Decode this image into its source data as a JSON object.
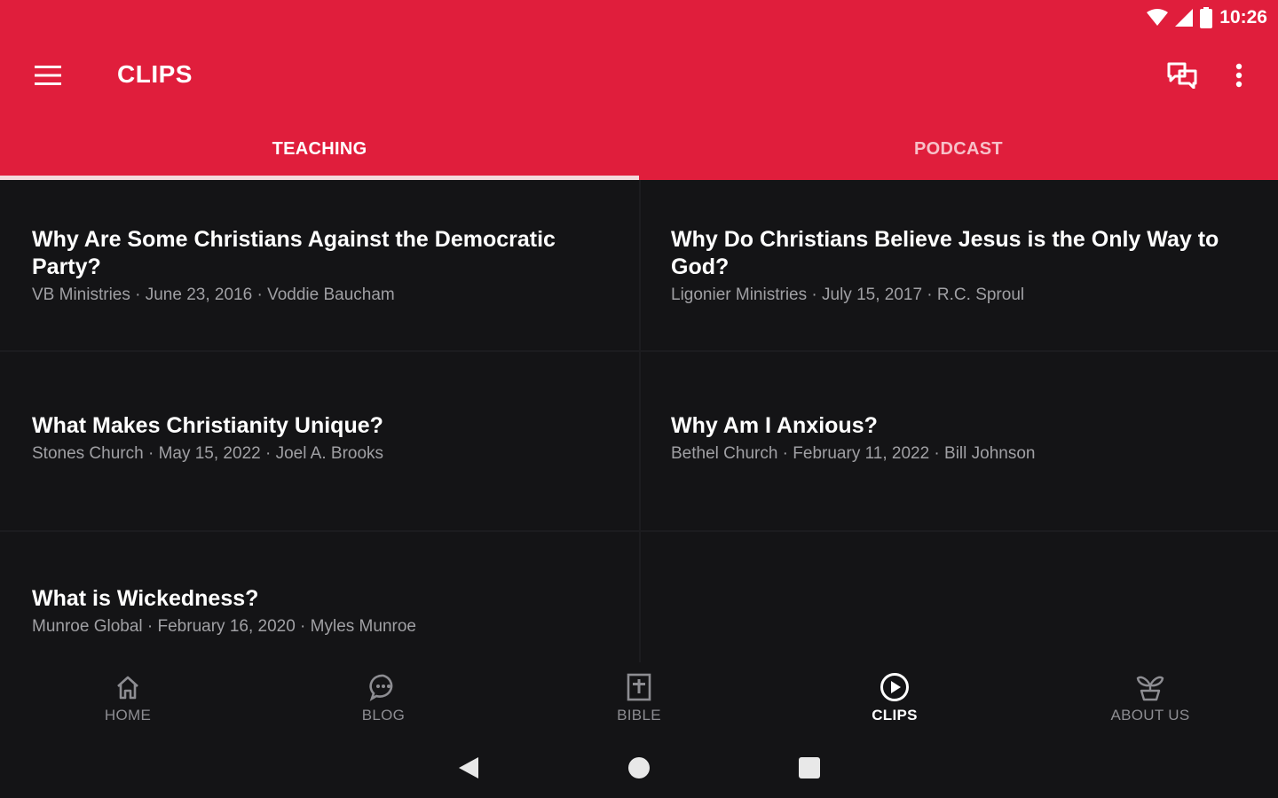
{
  "status_bar": {
    "time": "10:26"
  },
  "toolbar": {
    "title": "CLIPS"
  },
  "tabs": [
    {
      "label": "TEACHING",
      "active": true
    },
    {
      "label": "PODCAST",
      "active": false
    }
  ],
  "clips": [
    {
      "title": "Why Are Some Christians Against the Democratic Party?",
      "meta": "VB Ministries · June 23, 2016 · Voddie Baucham"
    },
    {
      "title": "Why Do Christians Believe Jesus is the Only Way to God?",
      "meta": "Ligonier Ministries · July 15, 2017 · R.C. Sproul"
    },
    {
      "title": "What Makes Christianity Unique?",
      "meta": "Stones Church · May 15, 2022 · Joel A. Brooks"
    },
    {
      "title": "Why Am I Anxious?",
      "meta": "Bethel Church · February 11, 2022 · Bill Johnson"
    },
    {
      "title": "What is Wickedness?",
      "meta": "Munroe Global · February 16, 2020 · Myles Munroe"
    }
  ],
  "bottom_nav": [
    {
      "label": "HOME",
      "icon": "home-icon",
      "active": false
    },
    {
      "label": "BLOG",
      "icon": "chat-bubble-icon",
      "active": false
    },
    {
      "label": "BIBLE",
      "icon": "bible-icon",
      "active": false
    },
    {
      "label": "CLIPS",
      "icon": "play-circle-icon",
      "active": true
    },
    {
      "label": "ABOUT US",
      "icon": "sprout-icon",
      "active": false
    }
  ],
  "colors": {
    "primary": "#e01e3c",
    "background": "#141416",
    "meta_text": "#a0a0a4",
    "inactive_nav": "#8d8d92"
  }
}
